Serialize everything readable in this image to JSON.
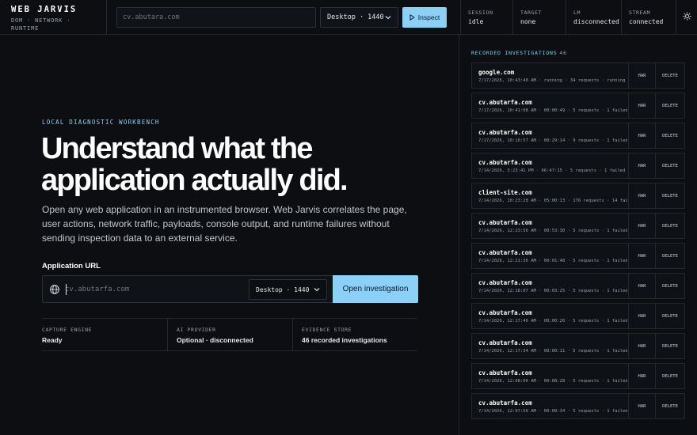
{
  "brand": {
    "title": "WEB JARVIS",
    "subtitle": "DOM · NETWORK · RUNTIME"
  },
  "toolbar": {
    "url_placeholder": "cv.abutara.com",
    "viewport": "Desktop · 1440",
    "inspect_label": "Inspect"
  },
  "status": {
    "session": {
      "label": "SESSION",
      "value": "idle"
    },
    "target": {
      "label": "TARGET",
      "value": "none"
    },
    "lm": {
      "label": "LM",
      "value": "disconnected"
    },
    "stream": {
      "label": "STREAM",
      "value": "connected"
    }
  },
  "icons": {
    "theme": "sun-icon",
    "url": "globe-icon",
    "inspect": "play-icon"
  },
  "colors": {
    "accent": "#8cd0f7",
    "background": "#0c0e12",
    "border": "#23272e"
  },
  "main": {
    "eyebrow": "LOCAL DIAGNOSTIC WORKBENCH",
    "headline": "Understand what the application actually did.",
    "lede": "Open any web application in an instrumented browser. Web Jarvis correlates the page, user actions, network traffic, payloads, console output, and runtime failures without sending inspection data to an external service.",
    "url_label": "Application URL",
    "url_placeholder": "cv.abutarfa.com",
    "viewport": "Desktop · 1440",
    "open_label": "Open investigation"
  },
  "facts": [
    {
      "label": "CAPTURE ENGINE",
      "value": "Ready"
    },
    {
      "label": "AI PROVIDER",
      "value": "Optional · disconnected"
    },
    {
      "label": "EVIDENCE STORE",
      "value": "46 recorded investigations"
    }
  ],
  "sidebar": {
    "title": "RECORDED INVESTIGATIONS",
    "count": "46",
    "har_label": "HAR",
    "delete_label": "DELETE",
    "items": [
      {
        "host": "google.com",
        "meta": "7/17/2026, 10:43:40 AM · running · 34 requests · running"
      },
      {
        "host": "cv.abutarfa.com",
        "meta": "7/17/2026, 10:41:08 AM · 00:00:49 · 5 requests · 1 failed"
      },
      {
        "host": "cv.abutarfa.com",
        "meta": "7/17/2026, 10:10:57 AM · 00:29:14 · 9 requests · 1 failed"
      },
      {
        "host": "cv.abutarfa.com",
        "meta": "7/14/2026, 3:23:41 PM · 66:47:15 · 5 requests · 1 failed"
      },
      {
        "host": "client-site.com",
        "meta": "7/14/2026, 10:23:28 AM · 05:00:13 · 176 requests · 14 failed"
      },
      {
        "host": "cv.abutarfa.com",
        "meta": "7/14/2026, 12:23:56 AM · 00:53:30 · 5 requests · 1 failed"
      },
      {
        "host": "cv.abutarfa.com",
        "meta": "7/14/2026, 12:21:36 AM · 00:01:48 · 5 requests · 1 failed"
      },
      {
        "host": "cv.abutarfa.com",
        "meta": "7/14/2026, 12:18:07 AM · 00:03:25 · 5 requests · 1 failed"
      },
      {
        "host": "cv.abutarfa.com",
        "meta": "7/14/2026, 12:17:46 AM · 00:00:20 · 5 requests · 1 failed"
      },
      {
        "host": "cv.abutarfa.com",
        "meta": "7/14/2026, 12:17:34 AM · 00:00:11 · 5 requests · 1 failed"
      },
      {
        "host": "cv.abutarfa.com",
        "meta": "7/14/2026, 12:08:06 AM · 00:08:28 · 5 requests · 1 failed"
      },
      {
        "host": "cv.abutarfa.com",
        "meta": "7/14/2026, 12:07:56 AM · 00:00:34 · 5 requests · 1 failed"
      }
    ]
  }
}
